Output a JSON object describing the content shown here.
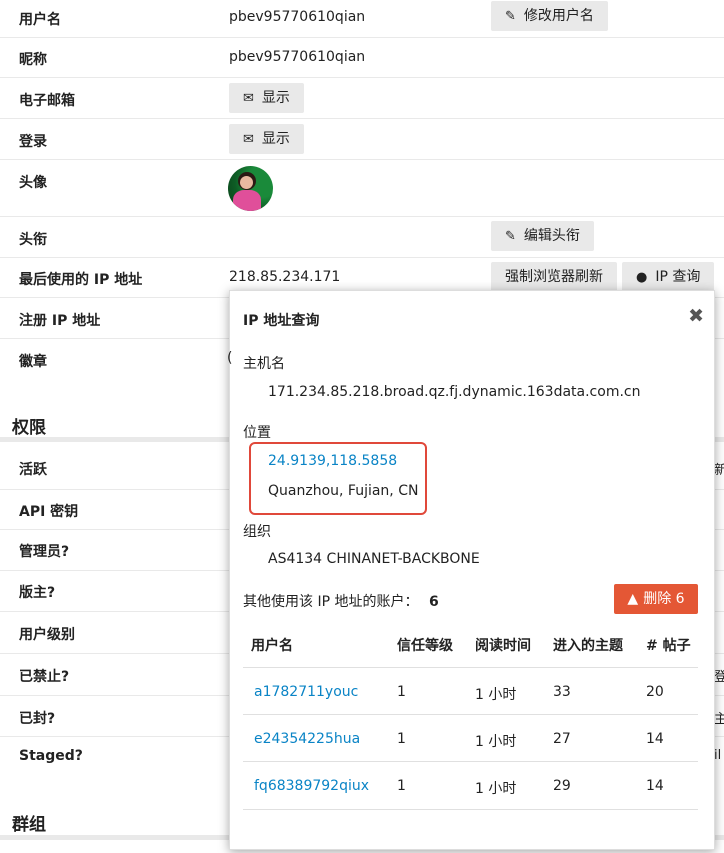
{
  "rows": {
    "username": {
      "label": "用户名",
      "value": "pbev95770610qian",
      "button": "修改用户名"
    },
    "nickname": {
      "label": "昵称",
      "value": "pbev95770610qian"
    },
    "email": {
      "label": "电子邮箱",
      "button": "显示"
    },
    "login": {
      "label": "登录",
      "button": "显示"
    },
    "avatar": {
      "label": "头像"
    },
    "title": {
      "label": "头衔",
      "button": "编辑头衔"
    },
    "last_ip": {
      "label": "最后使用的 IP 地址",
      "value": "218.85.234.171",
      "button_refresh": "强制浏览器刷新",
      "button_lookup": "IP 查询"
    },
    "reg_ip": {
      "label": "注册 IP 地址"
    },
    "badges": {
      "label": "徽章",
      "peek": "("
    }
  },
  "sections": {
    "permissions": "权限",
    "groups": "群组"
  },
  "perm_rows": [
    {
      "label": "活跃",
      "peek_right": "新"
    },
    {
      "label": "API 密钥",
      "peek_right": ""
    },
    {
      "label": "管理员?",
      "peek_right": ""
    },
    {
      "label": "版主?",
      "peek_right": ""
    },
    {
      "label": "用户级别",
      "peek_right": ""
    },
    {
      "label": "已禁止?",
      "peek_right": "登"
    },
    {
      "label": "已封?",
      "peek_right": "主"
    },
    {
      "label": "Staged?",
      "peek_right": "il"
    }
  ],
  "popup": {
    "title": "IP 地址查询",
    "hostname_label": "主机名",
    "hostname": "171.234.85.218.broad.qz.fj.dynamic.163data.com.cn",
    "location_label": "位置",
    "coords": "24.9139,118.5858",
    "city": "Quanzhou, Fujian, CN",
    "org_label": "组织",
    "org": "AS4134 CHINANET-BACKBONE",
    "other_accounts_label": "其他使用该 IP 地址的账户：",
    "other_accounts_count": "6",
    "delete_button": "删除 6",
    "columns": [
      "用户名",
      "信任等级",
      "阅读时间",
      "进入的主题",
      "# 帖子"
    ],
    "accounts": [
      {
        "username": "a1782711youc",
        "trust": "1",
        "read_time": "1 小时",
        "topics": "33",
        "posts": "20"
      },
      {
        "username": "e24354225hua",
        "trust": "1",
        "read_time": "1 小时",
        "topics": "27",
        "posts": "14"
      },
      {
        "username": "fq68389792qiux",
        "trust": "1",
        "read_time": "1 小时",
        "topics": "29",
        "posts": "14"
      }
    ]
  },
  "icons": {
    "edit": "pencil-icon",
    "mail": "envelope-icon",
    "globe": "globe-icon",
    "close": "close-icon",
    "warning": "warning-icon"
  },
  "colors": {
    "link": "#0a84c6",
    "danger": "#e45735",
    "highlight_box": "#e0483a",
    "button_bg": "#e9e9e9"
  }
}
